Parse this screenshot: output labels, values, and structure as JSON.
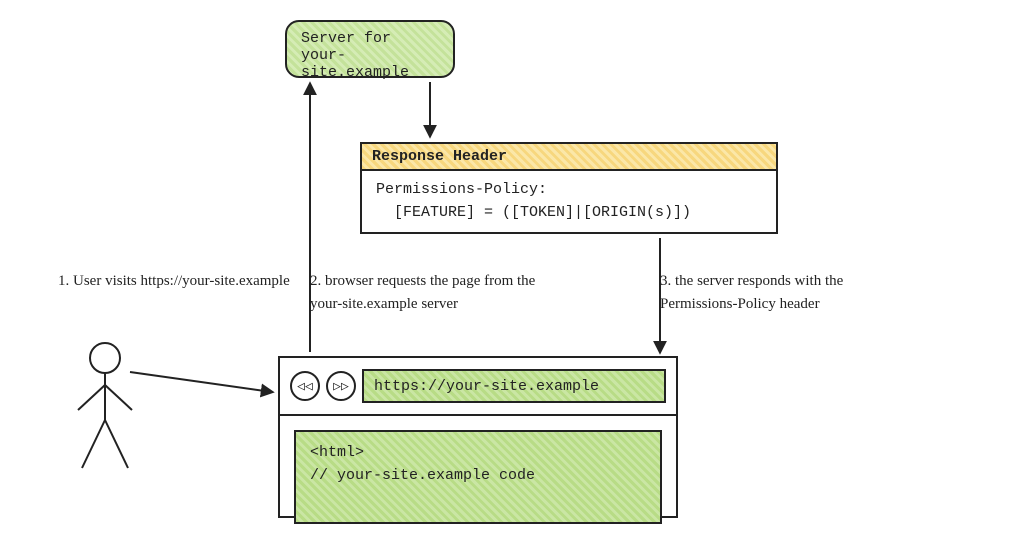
{
  "server": {
    "line1": "Server for",
    "line2": "your-site.example"
  },
  "response": {
    "header_label": "Response Header",
    "policy_line1": "Permissions-Policy:",
    "policy_line2": "  [FEATURE] = ([TOKEN]|[ORIGIN(s)])"
  },
  "captions": {
    "step1": "1. User visits https://your-site.example",
    "step2": "2. browser requests the page from the your-site.example server",
    "step3": "3. the server responds with the Permissions-Policy header"
  },
  "browser": {
    "back_glyph": "◁◁",
    "fwd_glyph": "▷▷",
    "url": "https://your-site.example",
    "code_line1": "<html>",
    "code_line2": "// your-site.example code"
  }
}
